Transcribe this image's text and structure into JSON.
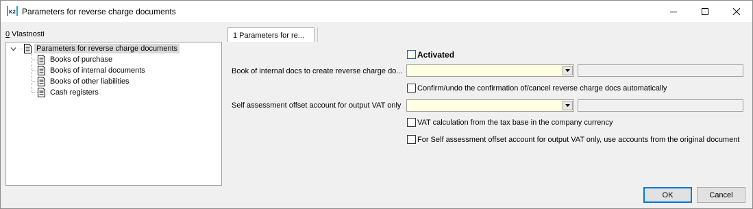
{
  "window": {
    "title": "Parameters for reverse charge documents",
    "app_icon": "k2-app-icon",
    "controls": [
      "minimize-icon",
      "maximize-icon",
      "close-icon"
    ]
  },
  "left_panel": {
    "label_prefix": "0",
    "label_rest": " Vlastnosti",
    "tree": {
      "root": {
        "label": "Parameters for reverse charge documents",
        "expander": "minus",
        "selected": true
      },
      "children": [
        {
          "label": "Books of purchase"
        },
        {
          "label": "Books of internal documents"
        },
        {
          "label": "Books of other liabilities"
        },
        {
          "label": "Cash registers"
        }
      ]
    }
  },
  "tab": {
    "label": "1 Parameters for re..."
  },
  "form": {
    "activated": {
      "label": "Activated",
      "checked": false
    },
    "book_internal": {
      "label": "Book of internal docs to create reverse charge do...",
      "value": "",
      "side_value": ""
    },
    "confirm_auto": {
      "label": "Confirm/undo the confirmation of/cancel reverse charge docs automatically",
      "checked": false
    },
    "self_assessment": {
      "label": "Self assessment offset account for output VAT only",
      "value": "",
      "side_value": ""
    },
    "vat_calc": {
      "label": "VAT calculation from the tax base in the company currency",
      "checked": false
    },
    "use_accounts": {
      "label": "For Self assessment offset account for output VAT only, use accounts from the original document",
      "checked": false
    }
  },
  "buttons": {
    "ok": "OK",
    "cancel": "Cancel"
  },
  "colors": {
    "accent": "#0078d7",
    "combo_bg": "#ffffe1",
    "selected_bg": "#d9d9d9"
  }
}
